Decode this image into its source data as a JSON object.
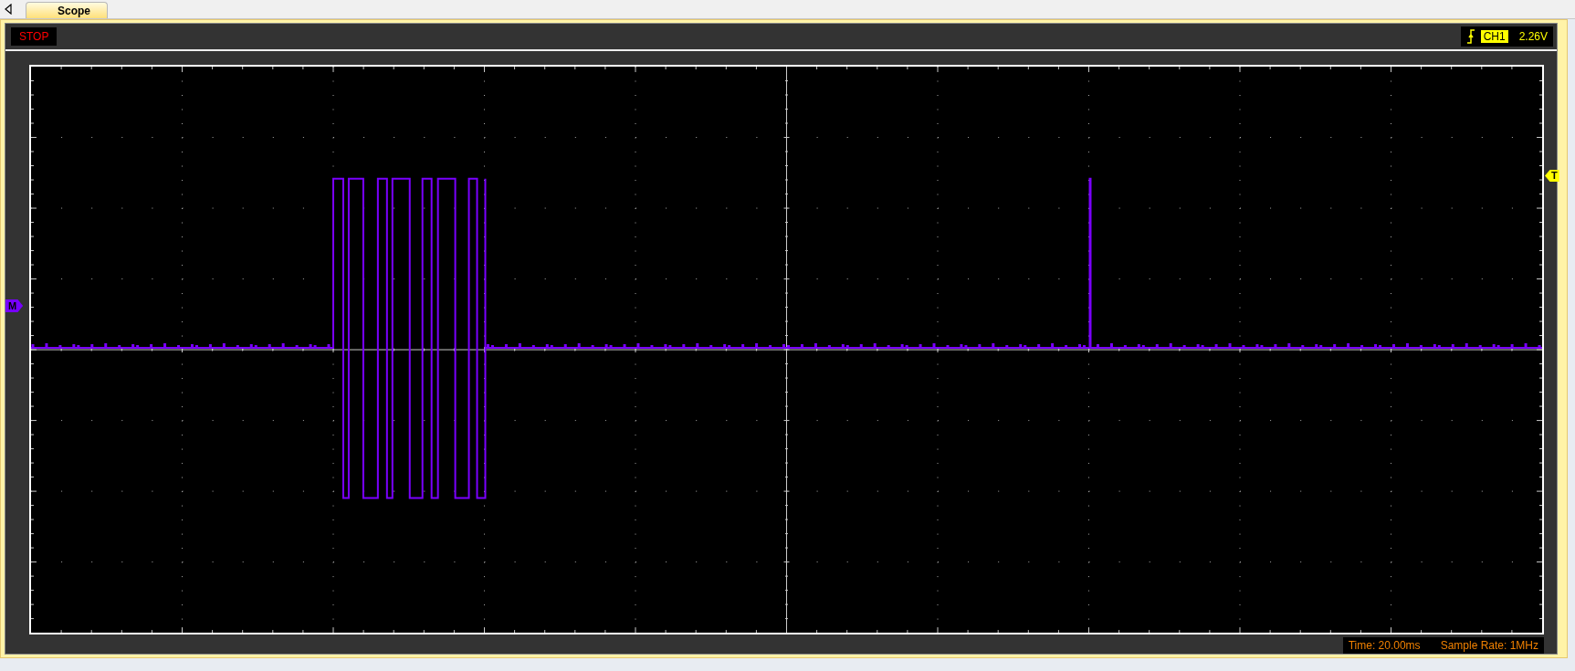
{
  "tabs": [
    {
      "label": "Scope",
      "selected": true
    }
  ],
  "status": {
    "run_state": "STOP"
  },
  "trigger": {
    "channel": "CH1",
    "level_reading": "2.26V",
    "marker": "T"
  },
  "channel_marker": "M",
  "footer": {
    "time": "Time: 20.00ms",
    "sample_rate": "Sample Rate: 1MHz"
  }
}
